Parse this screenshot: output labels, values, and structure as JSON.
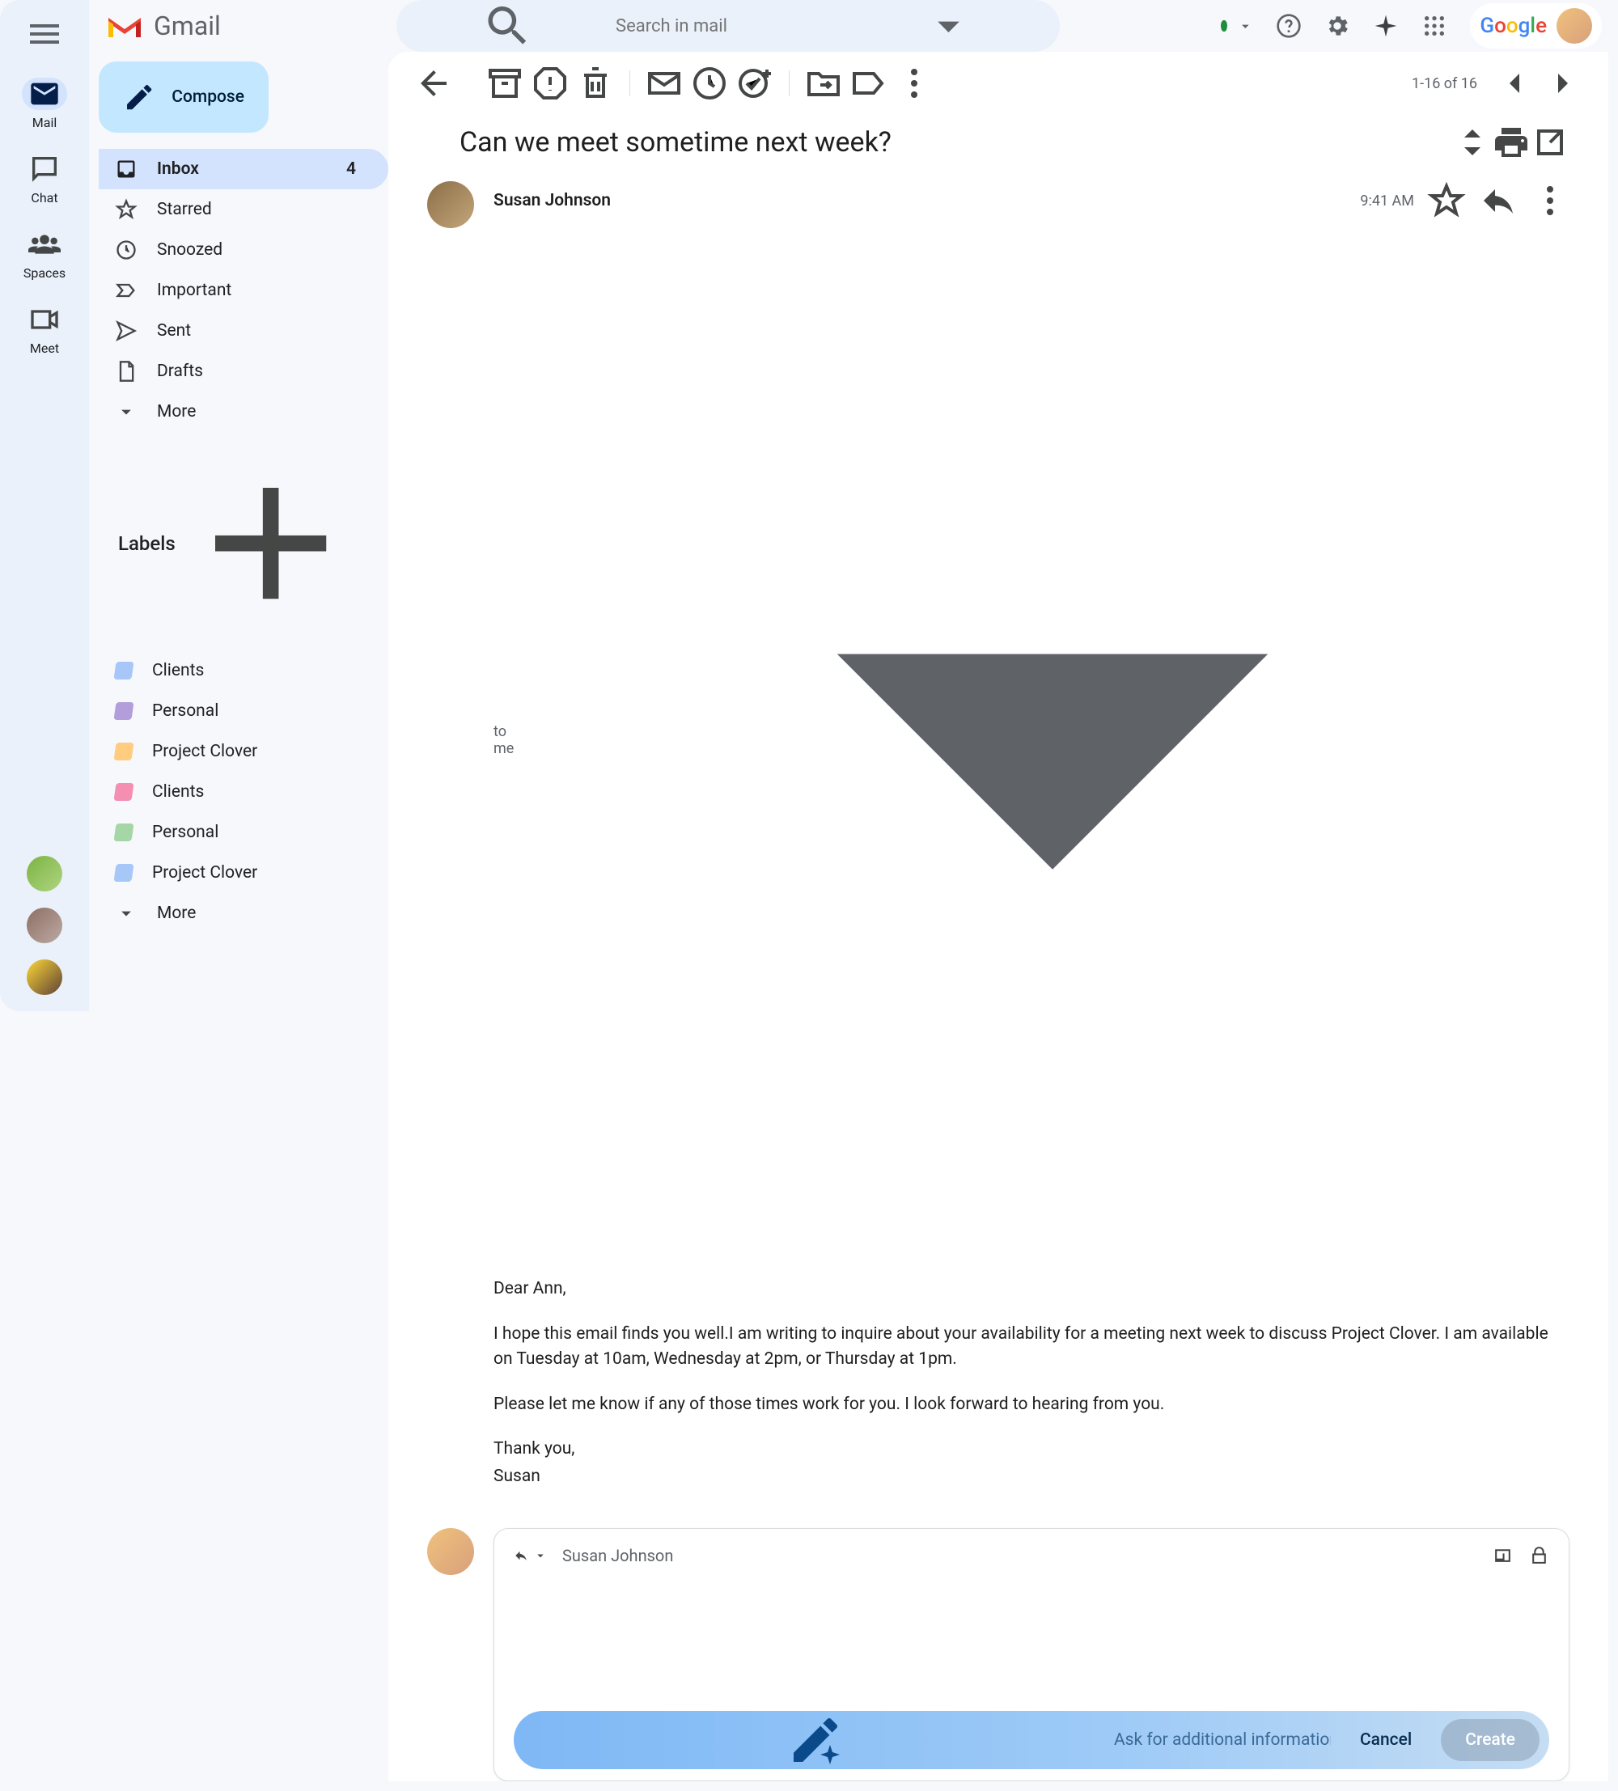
{
  "app_name": "Gmail",
  "search": {
    "placeholder": "Search in mail"
  },
  "rail": {
    "mail": "Mail",
    "chat": "Chat",
    "spaces": "Spaces",
    "meet": "Meet"
  },
  "compose_label": "Compose",
  "folders": [
    {
      "name": "Inbox",
      "count": "4",
      "icon": "inbox"
    },
    {
      "name": "Starred",
      "icon": "star"
    },
    {
      "name": "Snoozed",
      "icon": "clock"
    },
    {
      "name": "Important",
      "icon": "important"
    },
    {
      "name": "Sent",
      "icon": "send"
    },
    {
      "name": "Drafts",
      "icon": "draft"
    },
    {
      "name": "More",
      "icon": "chevron"
    }
  ],
  "labels_header": "Labels",
  "labels": [
    {
      "name": "Clients",
      "color": "#a7c7f9"
    },
    {
      "name": "Personal",
      "color": "#b39ddb"
    },
    {
      "name": "Project Clover",
      "color": "#ffcc80"
    },
    {
      "name": "Clients",
      "color": "#f48fb1"
    },
    {
      "name": "Personal",
      "color": "#a5d6a7"
    },
    {
      "name": "Project Clover",
      "color": "#a7c7f9"
    },
    {
      "name": "More",
      "color": ""
    }
  ],
  "pagination": "1-16 of 16",
  "email": {
    "subject": "Can we meet sometime next week?",
    "sender": "Susan Johnson",
    "to": "to me",
    "time": "9:41 AM",
    "body": {
      "greeting": "Dear Ann,",
      "p1": "I hope this email finds you well.I am writing to inquire about your availability for a meeting next week to discuss Project Clover. I am available on Tuesday at 10am, Wednesday at 2pm, or Thursday at 1pm.",
      "p2": "Please let me know if any of those times work for you. I look forward to hearing from you.",
      "thanks": "Thank you,",
      "sig": "Susan"
    }
  },
  "reply": {
    "to": "Susan Johnson",
    "ai_placeholder": "Ask for additional information or context",
    "cancel": "Cancel",
    "create": "Create"
  },
  "google_logo": "Google"
}
